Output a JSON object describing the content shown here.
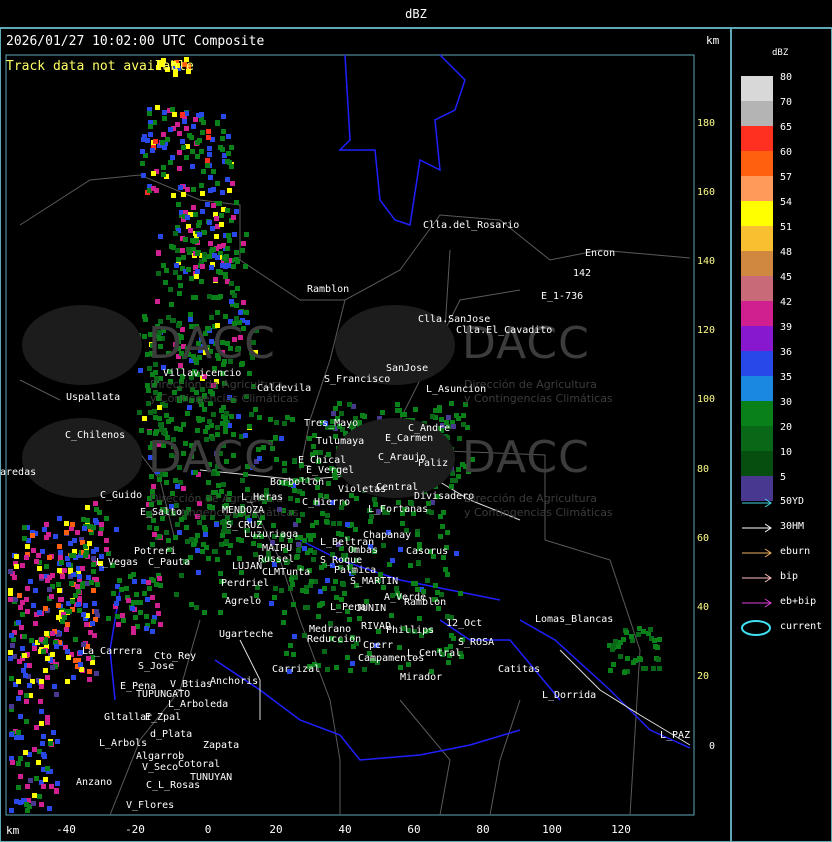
{
  "window": {
    "title": "dBZ"
  },
  "header": {
    "timestamp": "2026/01/27 10:02:00 UTC Composite",
    "track_note": "Track data not available",
    "km_top": "km",
    "km_bottom": "km"
  },
  "axes": {
    "y_ticks": [
      "180",
      "160",
      "140",
      "120",
      "100",
      "80",
      "60",
      "40",
      "20",
      "0"
    ],
    "x_ticks": [
      "-40",
      "-20",
      "0",
      "20",
      "40",
      "60",
      "80",
      "100",
      "120"
    ]
  },
  "places": [
    "Clla.del_Rosario",
    "Encon",
    "142",
    "E_1-736",
    "Ramblon",
    "Clla.SanJose",
    "Clla.El_Cavadito",
    "Villavicencio",
    "Caldevila",
    "S_Francisco",
    "SanJose",
    "L_Asuncion",
    "Uspallata",
    "Tres_Mayo",
    "Tulumaya",
    "C_Andre",
    "E_Carmen",
    "C_Chilenos",
    "E_Chical",
    "E_Vergel",
    "C_Araujo",
    "Paliz",
    "aredas",
    "Borbollon",
    "Violetas",
    "Central",
    "Divisadero",
    "C_Guido",
    "L_Heras",
    "C_Hierro",
    "L_Fortanas",
    "E_Salto",
    "MENDOZA",
    "S_CRUZ",
    "Luzuriaga",
    "Chapanay",
    "MAIPU",
    "L_Beltran",
    "Ombas",
    "Casorus",
    "Potreri",
    "L_Vegas",
    "C_Pauta",
    "Russel",
    "S_Roque",
    "LUJAN",
    "CLMTunta",
    "Palmica",
    "Perdriel",
    "S_MARTIN",
    "A_Verde",
    "Ramblon",
    "Agrelo",
    "L_Pena",
    "JUNIN",
    "12_Oct",
    "Ugarteche",
    "Medrano",
    "RIVAD",
    "Phillips",
    "Lomas_Blancas",
    "Reduccion",
    "Cperr",
    "S_ROSA",
    "La_Carrera",
    "Cto_Rey",
    "Campamentos",
    "L_Central",
    "S_Jose",
    "Carrizal",
    "Catitas",
    "E_Pena",
    "V_Btias",
    "Anchoris",
    "TUPUNGATO",
    "Mirador",
    "L_Dorrida",
    "L_Arboleda",
    "Gltallar",
    "E_Zpal",
    "d_Plata",
    "L_PAZ",
    "L_Arbols",
    "Zapata",
    "Algarrob",
    "V_Seco",
    "Cotoral",
    "Anzano",
    "TUNUYAN",
    "C_L_Rosas",
    "V_Flores"
  ],
  "watermark": {
    "brand": "DACC",
    "line1": "Dirección de Agricultura",
    "line2": "y Contingencias Climáticas",
    "brand_b": "DACC",
    "line1_b": "Dirección de Agricultura",
    "line2_b": "y Contingencias Climáticas",
    "brand_c": "DACC",
    "line1_c": "Dirección de Agricultura",
    "line2_c": "y Contingencias Climáticas",
    "brand_d": "DACC",
    "line1_d": "Dirección de Agricultura",
    "line2_d": "y Contingencias Climáticas"
  },
  "legend": {
    "title": "dBZ",
    "scale": [
      {
        "label": "80",
        "color": "#d8d8d8"
      },
      {
        "label": "70",
        "color": "#b4b4b4"
      },
      {
        "label": "65",
        "color": "#ff3020"
      },
      {
        "label": "60",
        "color": "#ff6010"
      },
      {
        "label": "57",
        "color": "#ff9a5a"
      },
      {
        "label": "54",
        "color": "#ffff00"
      },
      {
        "label": "51",
        "color": "#f8c030"
      },
      {
        "label": "48",
        "color": "#d08840"
      },
      {
        "label": "45",
        "color": "#c86a78"
      },
      {
        "label": "42",
        "color": "#d02090"
      },
      {
        "label": "39",
        "color": "#8818d0"
      },
      {
        "label": "36",
        "color": "#2848e8"
      },
      {
        "label": "35",
        "color": "#1a88e0"
      },
      {
        "label": "30",
        "color": "#0a8018"
      },
      {
        "label": "20",
        "color": "#086818"
      },
      {
        "label": "10",
        "color": "#064e10"
      },
      {
        "label": "5",
        "color": "#483890"
      }
    ],
    "tracks": [
      {
        "label": "50YD",
        "color": "#40d8e0"
      },
      {
        "label": "30HM",
        "color": "#ffffff"
      },
      {
        "label": "eburn",
        "color": "#f0b060"
      },
      {
        "label": "bip",
        "color": "#ffc0c0"
      },
      {
        "label": "eb+bip",
        "color": "#e040e0"
      },
      {
        "label": "current",
        "color": "#40e0f0"
      }
    ]
  }
}
